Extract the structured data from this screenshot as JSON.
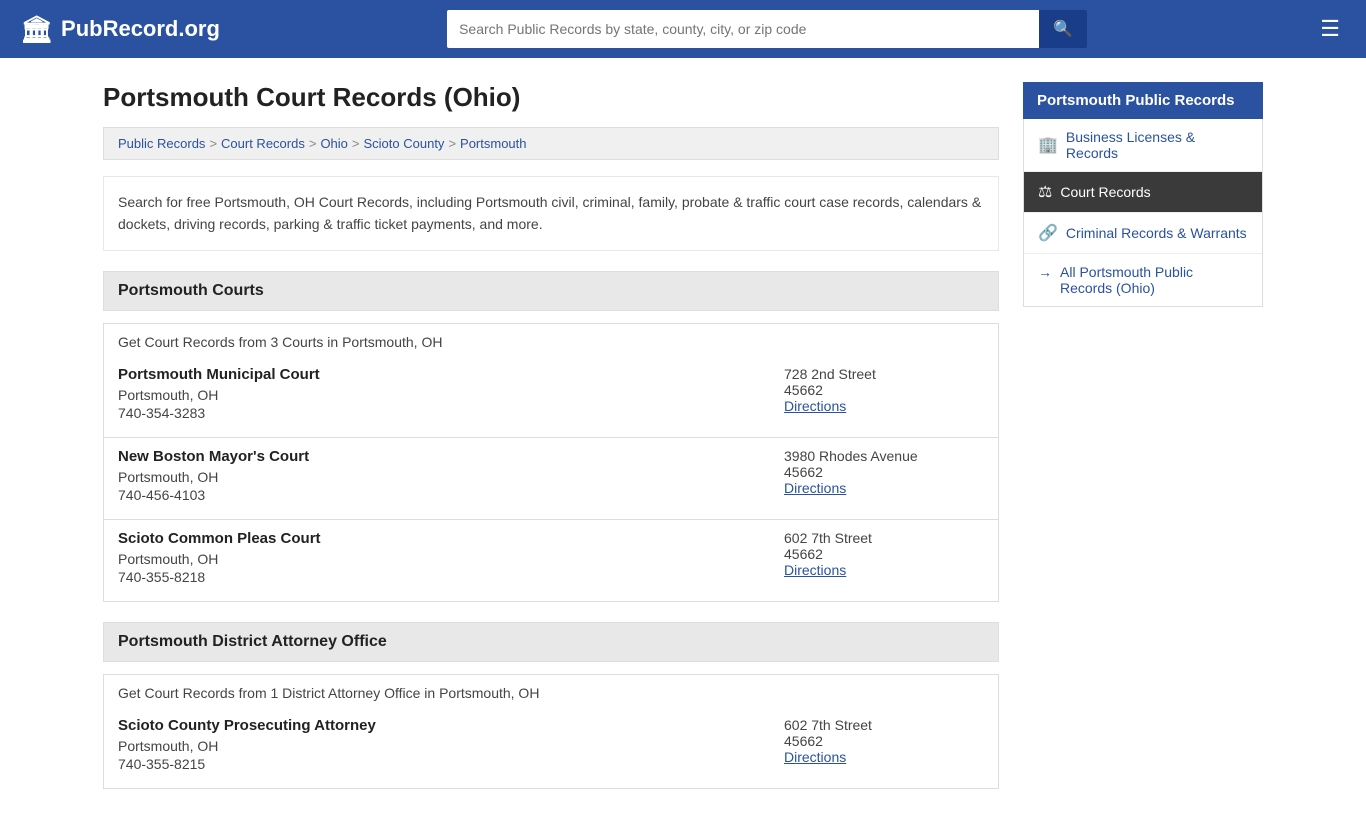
{
  "header": {
    "logo_text": "PubRecord.org",
    "logo_icon": "🏛",
    "search_placeholder": "Search Public Records by state, county, city, or zip code",
    "search_btn_icon": "🔍",
    "menu_icon": "☰"
  },
  "page": {
    "title": "Portsmouth Court Records (Ohio)"
  },
  "breadcrumb": {
    "items": [
      {
        "label": "Public Records",
        "href": "#"
      },
      {
        "label": "Court Records",
        "href": "#"
      },
      {
        "label": "Ohio",
        "href": "#"
      },
      {
        "label": "Scioto County",
        "href": "#"
      },
      {
        "label": "Portsmouth",
        "href": "#"
      }
    ]
  },
  "description": "Search for free Portsmouth, OH Court Records, including Portsmouth civil, criminal, family, probate & traffic court case records, calendars & dockets, driving records, parking & traffic ticket payments, and more.",
  "courts_section": {
    "header": "Portsmouth Courts",
    "sub_desc": "Get Court Records from 3 Courts in Portsmouth, OH",
    "courts": [
      {
        "name": "Portsmouth Municipal Court",
        "city": "Portsmouth, OH",
        "phone": "740-354-3283",
        "address": "728 2nd Street",
        "zip": "45662",
        "directions_label": "Directions"
      },
      {
        "name": "New Boston Mayor's Court",
        "city": "Portsmouth, OH",
        "phone": "740-456-4103",
        "address": "3980 Rhodes Avenue",
        "zip": "45662",
        "directions_label": "Directions"
      },
      {
        "name": "Scioto Common Pleas Court",
        "city": "Portsmouth, OH",
        "phone": "740-355-8218",
        "address": "602 7th Street",
        "zip": "45662",
        "directions_label": "Directions"
      }
    ]
  },
  "da_section": {
    "header": "Portsmouth District Attorney Office",
    "sub_desc": "Get Court Records from 1 District Attorney Office in Portsmouth, OH",
    "offices": [
      {
        "name": "Scioto County Prosecuting Attorney",
        "city": "Portsmouth, OH",
        "phone": "740-355-8215",
        "address": "602 7th Street",
        "zip": "45662",
        "directions_label": "Directions"
      }
    ]
  },
  "sidebar": {
    "title": "Portsmouth Public Records",
    "items": [
      {
        "icon": "🏢",
        "label": "Business Licenses & Records",
        "active": false
      },
      {
        "icon": "⚖",
        "label": "Court Records",
        "active": true
      },
      {
        "icon": "🔗",
        "label": "Criminal Records & Warrants",
        "active": false
      }
    ],
    "all_link_arrow": "→",
    "all_link_label": "All Portsmouth Public Records (Ohio)"
  }
}
